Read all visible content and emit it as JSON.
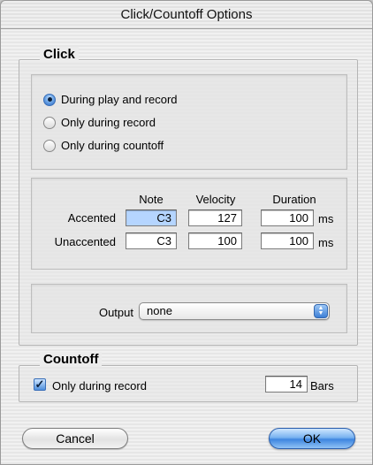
{
  "window": {
    "title": "Click/Countoff Options"
  },
  "click_group": {
    "title": "Click",
    "mode_options": [
      {
        "label": "During play and record",
        "selected": true
      },
      {
        "label": "Only during record",
        "selected": false
      },
      {
        "label": "Only during countoff",
        "selected": false
      }
    ],
    "columns": {
      "note": "Note",
      "velocity": "Velocity",
      "duration": "Duration"
    },
    "rows": [
      {
        "label": "Accented",
        "note": "C3",
        "velocity": "127",
        "duration": "100",
        "unit": "ms"
      },
      {
        "label": "Unaccented",
        "note": "C3",
        "velocity": "100",
        "duration": "100",
        "unit": "ms"
      }
    ],
    "output": {
      "label": "Output",
      "selected_value": "none"
    }
  },
  "countoff_group": {
    "title": "Countoff",
    "only_during_record": {
      "label": "Only during record",
      "checked": true
    },
    "bars": {
      "value": "14",
      "unit": "Bars"
    }
  },
  "buttons": {
    "cancel": "Cancel",
    "ok": "OK"
  },
  "colors": {
    "accent_blue": "#3f86e0",
    "selection": "#b5d5ff"
  }
}
